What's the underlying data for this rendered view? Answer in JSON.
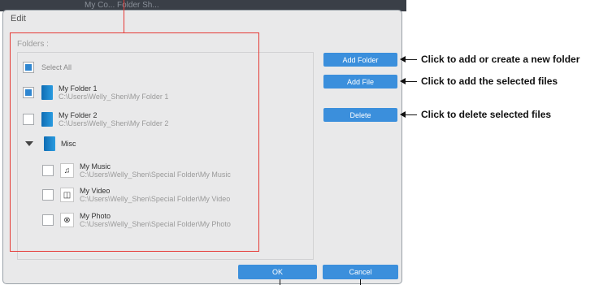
{
  "window": {
    "title": "Edit"
  },
  "tree": {
    "label": "Folders :",
    "select_all": {
      "label": "Select All",
      "checked": true
    },
    "items": [
      {
        "name": "My Folder 1",
        "path": "C:\\Users\\Welly_Shen\\My Folder 1",
        "checked": true,
        "icon": "folder-icon"
      },
      {
        "name": "My Folder 2",
        "path": "C:\\Users\\Welly_Shen\\My Folder 2",
        "checked": false,
        "icon": "folder-icon"
      }
    ],
    "misc": {
      "label": "Misc",
      "expanded": true,
      "icon": "folder-icon"
    },
    "misc_items": [
      {
        "name": "My Music",
        "path": "C:\\Users\\Welly_Shen\\Special Folder\\My Music",
        "checked": false,
        "icon": "music-note-icon"
      },
      {
        "name": "My Video",
        "path": "C:\\Users\\Welly_Shen\\Special Folder\\My Video",
        "checked": false,
        "icon": "film-icon"
      },
      {
        "name": "My Photo",
        "path": "C:\\Users\\Welly_Shen\\Special Folder\\My Photo",
        "checked": false,
        "icon": "camera-icon"
      }
    ]
  },
  "buttons": {
    "add_folder": "Add Folder",
    "add_file": "Add File",
    "delete": "Delete",
    "ok": "OK",
    "cancel": "Cancel"
  },
  "callouts": {
    "add_folder": "Click to add or create a new folder",
    "add_file": "Click to add the selected files",
    "delete": "Click to delete selected files"
  },
  "colors": {
    "accent": "#3b8fdc",
    "annotation": "#e53935",
    "folder": "#1a86cf"
  }
}
